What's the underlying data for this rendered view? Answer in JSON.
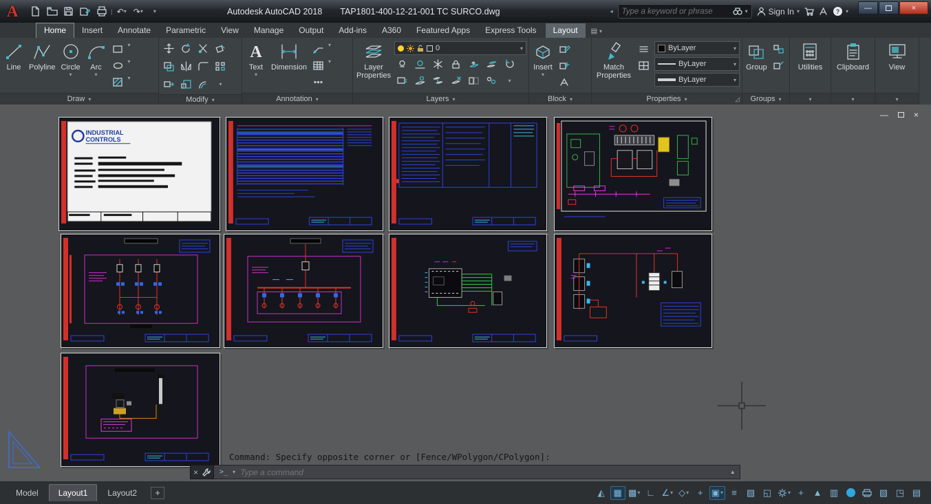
{
  "titlebar": {
    "app_title": "Autodesk AutoCAD 2018",
    "doc_title": "TAP1801-400-12-21-001  TC SURCO.dwg",
    "search_placeholder": "Type a keyword or phrase",
    "sign_in_label": "Sign In"
  },
  "ribbon": {
    "tabs": [
      "Home",
      "Insert",
      "Annotate",
      "Parametric",
      "View",
      "Manage",
      "Output",
      "Add-ins",
      "A360",
      "Featured Apps",
      "Express Tools",
      "Layout"
    ],
    "active_tab": "Home",
    "panels": {
      "draw": {
        "label": "Draw",
        "line": "Line",
        "polyline": "Polyline",
        "circle": "Circle",
        "arc": "Arc"
      },
      "modify": {
        "label": "Modify"
      },
      "annotation": {
        "label": "Annotation",
        "text": "Text",
        "dimension": "Dimension"
      },
      "layers": {
        "label": "Layers",
        "layer_properties": "Layer Properties",
        "current_layer": "0"
      },
      "block": {
        "label": "Block",
        "insert": "Insert"
      },
      "properties": {
        "label": "Properties",
        "match_properties": "Match Properties",
        "color_value": "ByLayer",
        "linetype_value": "ByLayer",
        "lineweight_value": "ByLayer"
      },
      "groups": {
        "label": "Groups",
        "group": "Group"
      },
      "utilities": {
        "label": "Utilities"
      },
      "clipboard": {
        "label": "Clipboard"
      },
      "view": {
        "label": "View"
      }
    }
  },
  "canvas": {
    "sheet1_logo_line1": "INDUSTRIAL",
    "sheet1_logo_line2": "CONTROLS"
  },
  "command": {
    "history_line": "Command: Specify opposite corner or [Fence/WPolygon/CPolygon]:",
    "input_placeholder": "Type a command"
  },
  "bottombar": {
    "tabs": [
      "Model",
      "Layout1",
      "Layout2"
    ],
    "active_tab": "Layout1",
    "new_layout_label": "+"
  },
  "colors": {
    "close_button_red": "#b03121",
    "sheet_red_bar": "#d2302a",
    "sheet_blue": "#2c43e0",
    "sheet_magenta": "#cc2fcc",
    "sheet_green": "#2ecc40",
    "accent_teal": "#45b9c6"
  }
}
